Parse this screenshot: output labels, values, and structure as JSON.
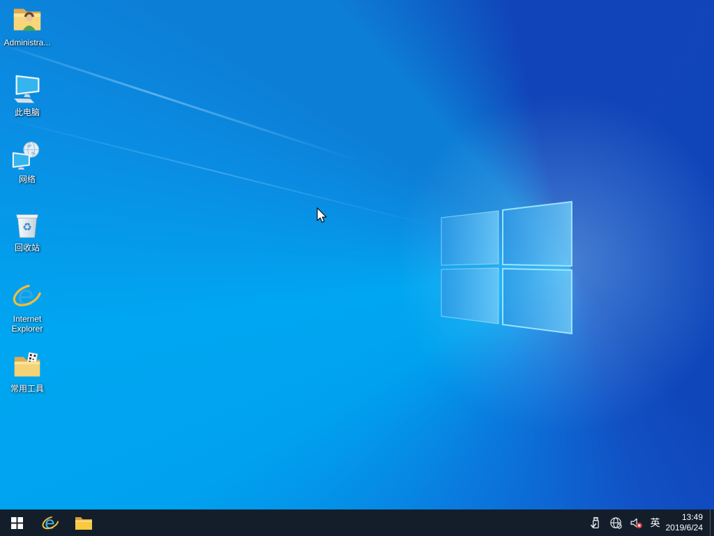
{
  "desktop": {
    "icons": [
      {
        "id": "administrator",
        "label": "Administra..."
      },
      {
        "id": "this-pc",
        "label": "此电脑"
      },
      {
        "id": "network",
        "label": "网络"
      },
      {
        "id": "recycle-bin",
        "label": "回收站"
      },
      {
        "id": "internet-explorer",
        "label": "Internet Explorer"
      },
      {
        "id": "common-tools",
        "label": "常用工具"
      }
    ]
  },
  "taskbar": {
    "buttons": [
      {
        "id": "start",
        "icon": "windows-logo-icon"
      },
      {
        "id": "internet-explorer",
        "icon": "ie-icon"
      },
      {
        "id": "file-explorer",
        "icon": "folder-icon"
      }
    ],
    "tray": {
      "icons": [
        {
          "id": "usb-device",
          "icon": "usb-eject-icon"
        },
        {
          "id": "network-status",
          "icon": "globe-no-internet-icon"
        },
        {
          "id": "volume",
          "icon": "speaker-muted-icon"
        }
      ],
      "ime": "英",
      "clock": {
        "time": "13:49",
        "date": "2019/6/24"
      }
    }
  },
  "colors": {
    "taskbar_bg": "#141e2b",
    "wallpaper_bright": "#00a6f1",
    "wallpaper_azure": "#0d7ed6",
    "wallpaper_dark": "#1144b8",
    "logo_edge": "#a5ecff",
    "mute_badge": "#d83b3b",
    "folder_yellow": "#f5d276",
    "ie_blue": "#35a5e5",
    "ie_gold": "#f0bd3a"
  }
}
